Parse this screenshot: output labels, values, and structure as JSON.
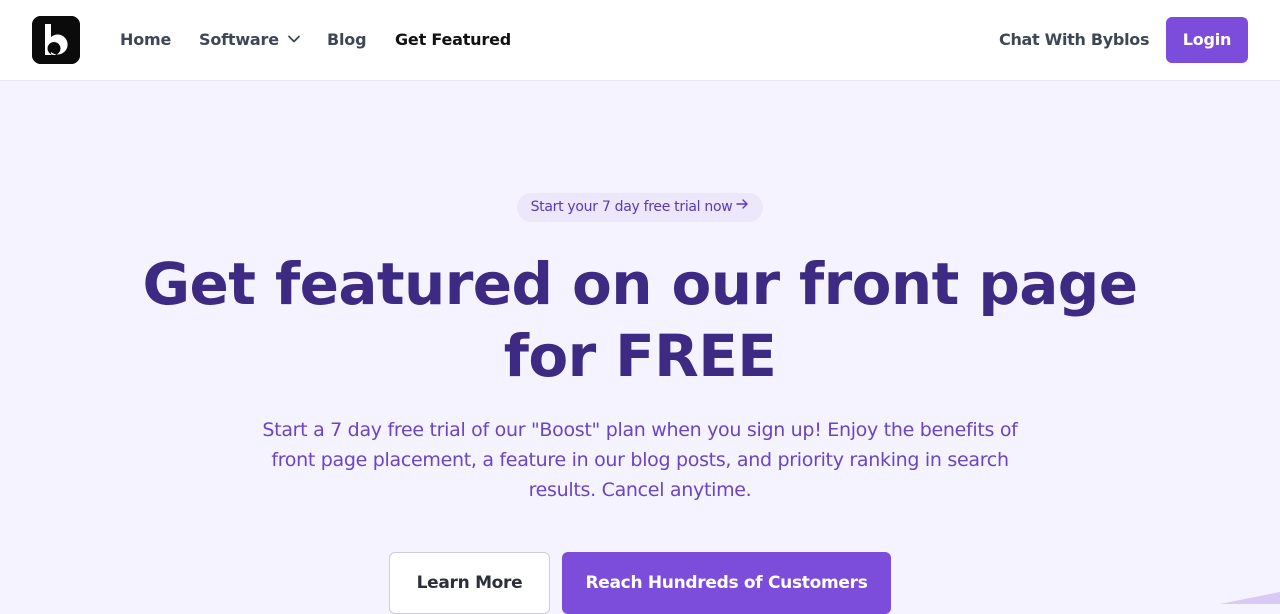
{
  "colors": {
    "brand": "#7c4ddb",
    "heading": "#3d2a82",
    "subtext": "#6a44c6",
    "background": "#f5f3ff"
  },
  "header": {
    "logo_icon": "byblos-b-logo",
    "nav": [
      {
        "label": "Home"
      },
      {
        "label": "Software",
        "icon": "chevron-down-icon"
      },
      {
        "label": "Blog"
      },
      {
        "label": "Get Featured",
        "active": true
      }
    ],
    "chat_label": "Chat With Byblos",
    "login_label": "Login"
  },
  "hero": {
    "pill_text": "Start your 7 day free trial now",
    "pill_icon": "arrow-right-icon",
    "title_line1": "Get featured on our front page",
    "title_line2": "for FREE",
    "subtitle": "Start a 7 day free trial of our \"Boost\" plan when you sign up! Enjoy the benefits of front page placement, a feature in our blog posts, and priority ranking in search results. Cancel anytime.",
    "learn_more_label": "Learn More",
    "reach_label": "Reach Hundreds of Customers"
  }
}
